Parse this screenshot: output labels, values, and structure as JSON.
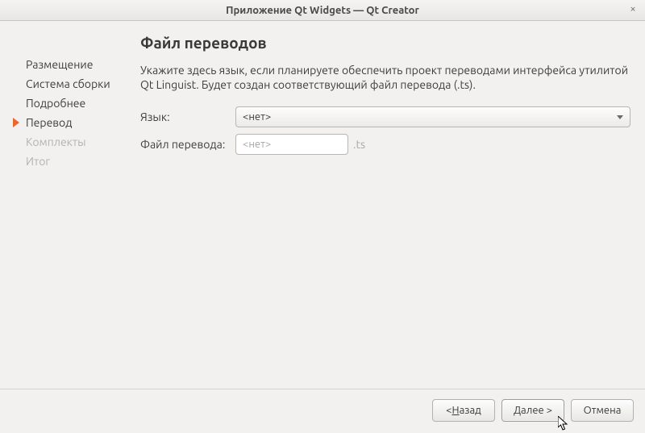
{
  "window": {
    "title": "Приложение Qt Widgets — Qt Creator"
  },
  "sidebar": {
    "items": [
      {
        "label": "Размещение",
        "state": "done"
      },
      {
        "label": "Система сборки",
        "state": "done"
      },
      {
        "label": "Подробнее",
        "state": "done"
      },
      {
        "label": "Перевод",
        "state": "current"
      },
      {
        "label": "Комплекты",
        "state": "disabled"
      },
      {
        "label": "Итог",
        "state": "disabled"
      }
    ]
  },
  "main": {
    "title": "Файл переводов",
    "description": "Укажите здесь язык, если планируете обеспечить проект переводами интерфейса утилитой Qt Linguist. Будет создан соответствующий файл перевода (.ts).",
    "language_label": "Язык:",
    "language_value": "<нет>",
    "file_label": "Файл перевода:",
    "file_placeholder": "<нет>",
    "file_value": "",
    "file_suffix": ".ts"
  },
  "buttons": {
    "back_prefix": "< ",
    "back_ul": "Н",
    "back_rest": "азад",
    "next_ul": "Д",
    "next_rest": "алее >",
    "cancel": "Отмена"
  }
}
